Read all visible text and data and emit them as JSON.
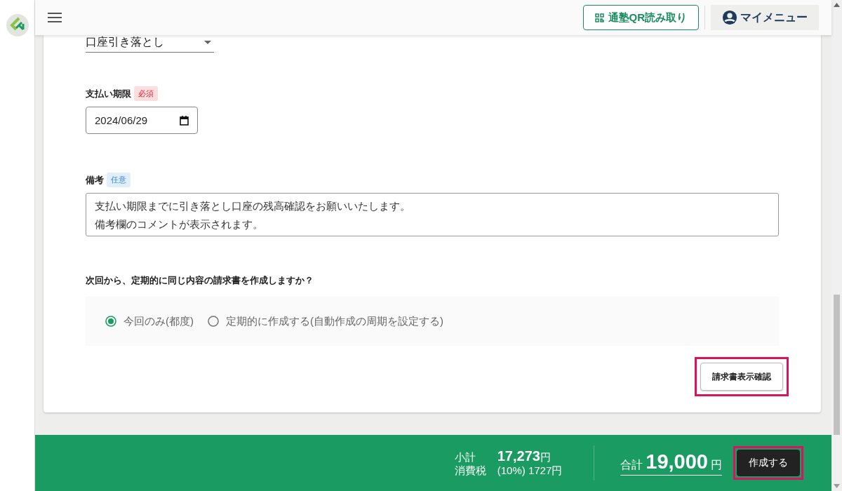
{
  "header": {
    "qr_button": "通塾QR読み取り",
    "my_menu": "マイメニュー"
  },
  "payment_method": {
    "value": "口座引き落とし"
  },
  "due_date": {
    "label": "支払い期限",
    "badge": {
      "text": "必須",
      "kind": "required"
    },
    "value": "2024/06/29"
  },
  "notes": {
    "label": "備考",
    "badge": {
      "text": "任意",
      "kind": "optional"
    },
    "lines": [
      "支払い期限までに引き落とし口座の残高確認をお願いいたします。",
      "備考欄のコメントが表示されます。"
    ]
  },
  "recurrence": {
    "question": "次回から、定期的に同じ内容の請求書を作成しますか？",
    "options": [
      {
        "label": "今回のみ(都度)",
        "selected": true
      },
      {
        "label": "定期的に作成する(自動作成の周期を設定する)",
        "selected": false
      }
    ]
  },
  "preview_button": {
    "label": "請求書表示確認",
    "highlighted": true
  },
  "footer": {
    "subtotal_label": "小計",
    "subtotal_value": "17,273",
    "subtotal_unit": "円",
    "tax_label": "消費税",
    "tax_detail": "(10%) 1727円",
    "total_label": "合計",
    "total_value": "19,000",
    "total_unit": "円",
    "create_button": {
      "label": "作成する",
      "highlighted": true
    }
  }
}
